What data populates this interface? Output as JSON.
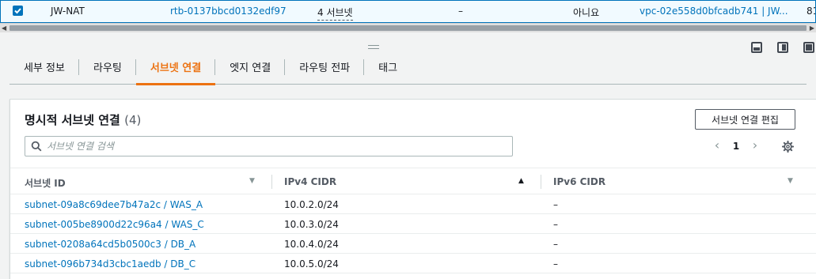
{
  "route_table_row": {
    "name": "JW-NAT",
    "route_table_id": "rtb-0137bbcd0132edf97",
    "explicit_subnets": "4 서브넷",
    "edge_associations": "–",
    "main": "아니요",
    "vpc": "vpc-02e558d0bfcadb741 | JW...",
    "owner": "81"
  },
  "tabs": [
    {
      "label": "세부 정보"
    },
    {
      "label": "라우팅"
    },
    {
      "label": "서브넷 연결"
    },
    {
      "label": "엣지 연결"
    },
    {
      "label": "라우팅 전파"
    },
    {
      "label": "태그"
    }
  ],
  "active_tab_index": 2,
  "section": {
    "title": "명시적 서브넷 연결",
    "count": "(4)",
    "edit_button": "서브넷 연결 편집",
    "search_placeholder": "서브넷 연결 검색",
    "page": "1"
  },
  "columns": {
    "subnet_id": "서브넷 ID",
    "ipv4": "IPv4 CIDR",
    "ipv6": "IPv6 CIDR"
  },
  "rows": [
    {
      "subnet": "subnet-09a8c69dee7b47a2c / WAS_A",
      "ipv4": "10.0.2.0/24",
      "ipv6": "–"
    },
    {
      "subnet": "subnet-005be8900d22c96a4 / WAS_C",
      "ipv4": "10.0.3.0/24",
      "ipv6": "–"
    },
    {
      "subnet": "subnet-0208a64cd5b0500c3 / DB_A",
      "ipv4": "10.0.4.0/24",
      "ipv6": "–"
    },
    {
      "subnet": "subnet-096b734d3cbc1aedb / DB_C",
      "ipv4": "10.0.5.0/24",
      "ipv6": "–"
    }
  ],
  "colors": {
    "link": "#0073bb",
    "active_tab": "#ec7211",
    "selected_row_bg": "#f1faff"
  },
  "icons": {
    "checkbox": "checkbox-checked-icon",
    "search": "search-icon",
    "settings": "gear-icon",
    "prev": "chevron-left-icon",
    "next": "chevron-right-icon"
  }
}
